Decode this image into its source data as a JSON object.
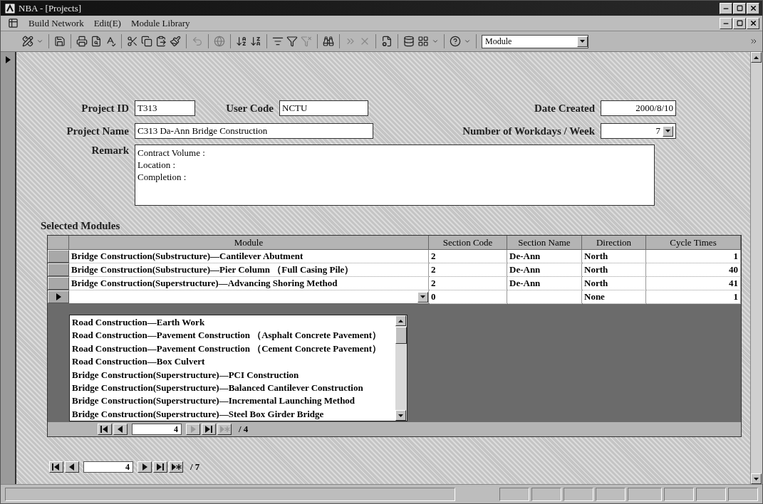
{
  "window": {
    "title": "NBA - [Projects]"
  },
  "menu": [
    "Build Network",
    "Edit(E)",
    "Module Library"
  ],
  "toolbar": {
    "combo_value": "Module"
  },
  "form": {
    "project_id": {
      "label": "Project ID",
      "value": "T313"
    },
    "user_code": {
      "label": "User Code",
      "value": "NCTU"
    },
    "date_created": {
      "label": "Date Created",
      "value": "2000/8/10"
    },
    "project_name": {
      "label": "Project Name",
      "value": "C313 Da-Ann Bridge Construction"
    },
    "workdays": {
      "label": "Number of Workdays / Week",
      "value": "7"
    },
    "remark": {
      "label": "Remark",
      "lines": [
        "Contract Volume :",
        "Location :",
        "Completion :"
      ]
    }
  },
  "selected_modules": {
    "title": "Selected Modules",
    "columns": [
      "Module",
      "Section Code",
      "Section Name",
      "Direction",
      "Cycle Times"
    ],
    "rows": [
      {
        "module": "Bridge Construction(Substructure)—Cantilever Abutment",
        "section_code": "2",
        "section_name": "De-Ann",
        "direction": "North",
        "cycle_times": "1",
        "selected": false
      },
      {
        "module": "Bridge Construction(Substructure)—Pier Column （Full Casing Pile）",
        "section_code": "2",
        "section_name": "De-Ann",
        "direction": "North",
        "cycle_times": "40",
        "selected": false
      },
      {
        "module": "Bridge Construction(Superstructure)—Advancing Shoring Method",
        "section_code": "2",
        "section_name": "De-Ann",
        "direction": "North",
        "cycle_times": "41",
        "selected": false
      },
      {
        "section_code": "0",
        "direction": "None",
        "cycle_times": "1",
        "selected": true
      }
    ],
    "dropdown": [
      "Road Construction—Earth Work",
      "Road Construction—Pavement Construction （Asphalt Concrete Pavement）",
      "Road Construction—Pavement Construction （Cement Concrete Pavement）",
      "Road Construction—Box Culvert",
      "Bridge Construction(Superstructure)—PCI Construction",
      "Bridge Construction(Superstructure)—Balanced Cantilever Construction",
      "Bridge Construction(Superstructure)—Incremental Launching Method",
      "Bridge Construction(Superstructure)—Steel Box Girder Bridge"
    ],
    "nav": {
      "record": "4",
      "total": "/ 4",
      "buttons": [
        {
          "kind": "first",
          "disabled": false
        },
        {
          "kind": "prev",
          "disabled": false
        },
        {
          "kind": "next",
          "disabled": true
        },
        {
          "kind": "last",
          "disabled": false
        },
        {
          "kind": "new",
          "disabled": true
        }
      ]
    }
  },
  "main_nav": {
    "record": "4",
    "total": "/ 7",
    "buttons": [
      {
        "kind": "first",
        "disabled": false
      },
      {
        "kind": "prev",
        "disabled": false
      },
      {
        "kind": "next",
        "disabled": false
      },
      {
        "kind": "last",
        "disabled": false
      },
      {
        "kind": "new",
        "disabled": false
      }
    ]
  }
}
